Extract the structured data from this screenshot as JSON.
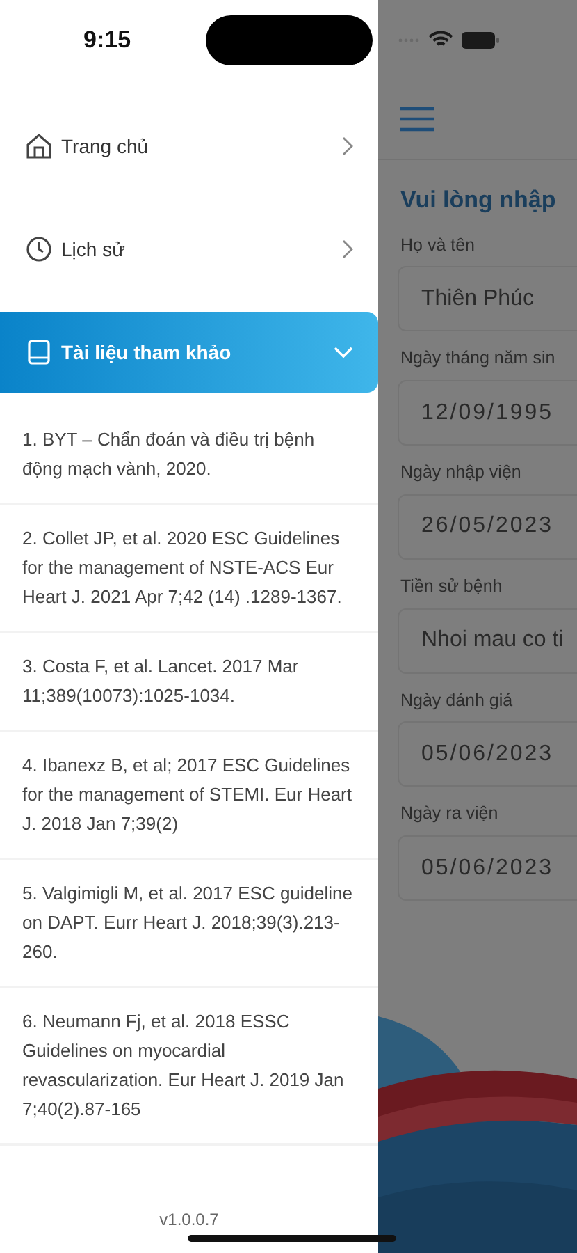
{
  "status_bar": {
    "time": "9:15"
  },
  "menu": [
    {
      "label": "Trang chủ",
      "kind": "home",
      "selected": false,
      "expanded": false
    },
    {
      "label": "Lịch sử",
      "kind": "clock",
      "selected": false,
      "expanded": false
    },
    {
      "label": "Tài liệu tham khảo",
      "kind": "book",
      "selected": true,
      "expanded": true
    }
  ],
  "references": [
    "1. BYT – Chẩn đoán và điều trị bệnh động mạch vành, 2020.",
    "2. Collet JP, et al. 2020 ESC Guidelines for the management of NSTE-ACS Eur Heart J. 2021 Apr 7;42 (14) .1289-1367.",
    "3. Costa F, et al. Lancet. 2017 Mar 11;389(10073):1025-1034.",
    "4. Ibanexz B, et al; 2017 ESC Guidelines for the management of STEMI. Eur Heart J. 2018 Jan 7;39(2)",
    "5. Valgimigli M, et al. 2017 ESC guideline on DAPT. Eurr Heart J. 2018;39(3).213-260.",
    "6. Neumann Fj, et al. 2018 ESSC Guidelines on myocardial revascularization. Eur Heart J. 2019 Jan 7;40(2).87-165"
  ],
  "version": "v1.0.0.7",
  "background_form": {
    "title": "Vui lòng nhập",
    "fields": [
      {
        "label": "Họ và tên",
        "value": "Thiên Phúc",
        "kind": "text"
      },
      {
        "label": "Ngày tháng năm sin",
        "value": "12/09/1995",
        "kind": "date"
      },
      {
        "label": "Ngày nhập viện",
        "value": "26/05/2023",
        "kind": "date"
      },
      {
        "label": "Tiền sử bệnh",
        "value": "Nhoi mau co ti",
        "kind": "text"
      },
      {
        "label": "Ngày đánh giá",
        "value": "05/06/2023",
        "kind": "date"
      },
      {
        "label": "Ngày ra viện",
        "value": "05/06/2023",
        "kind": "date"
      }
    ]
  }
}
